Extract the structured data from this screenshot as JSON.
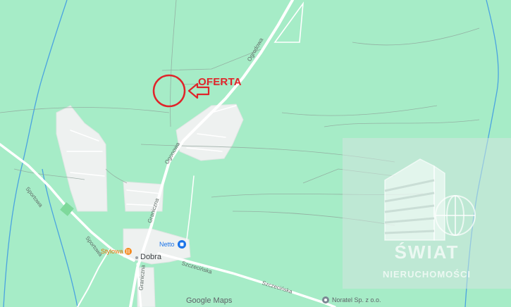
{
  "map": {
    "annotation": {
      "label": "OFERTA",
      "color": "#e0242a"
    },
    "places": [
      {
        "name": "Dobra"
      }
    ],
    "streets": [
      {
        "name": "Ogrodowa"
      },
      {
        "name": "Ogonowa"
      },
      {
        "name": "Graniczna"
      },
      {
        "name": "Graniczna"
      },
      {
        "name": "Sportowa"
      },
      {
        "name": "Sportowa"
      },
      {
        "name": "Szczecińska"
      },
      {
        "name": "Szczecińska"
      }
    ],
    "pois": [
      {
        "name": "Netto",
        "icon": "shopping-bag-icon",
        "color": "#1a73e8"
      },
      {
        "name": "Stylowa",
        "icon": "restaurant-icon",
        "color": "#f58a1f"
      },
      {
        "name": "Noratel Sp. z o.o.",
        "icon": "pin-icon",
        "color": "#7b8793"
      }
    ],
    "attribution": "Google Maps",
    "colors": {
      "land": "#a6ecc7",
      "urban": "#eef1f0",
      "road": "#ffffff",
      "water": "#4aa3e0"
    }
  },
  "watermark": {
    "line1": "ŚWIAT",
    "line2": "NIERUCHOMOŚCI"
  }
}
